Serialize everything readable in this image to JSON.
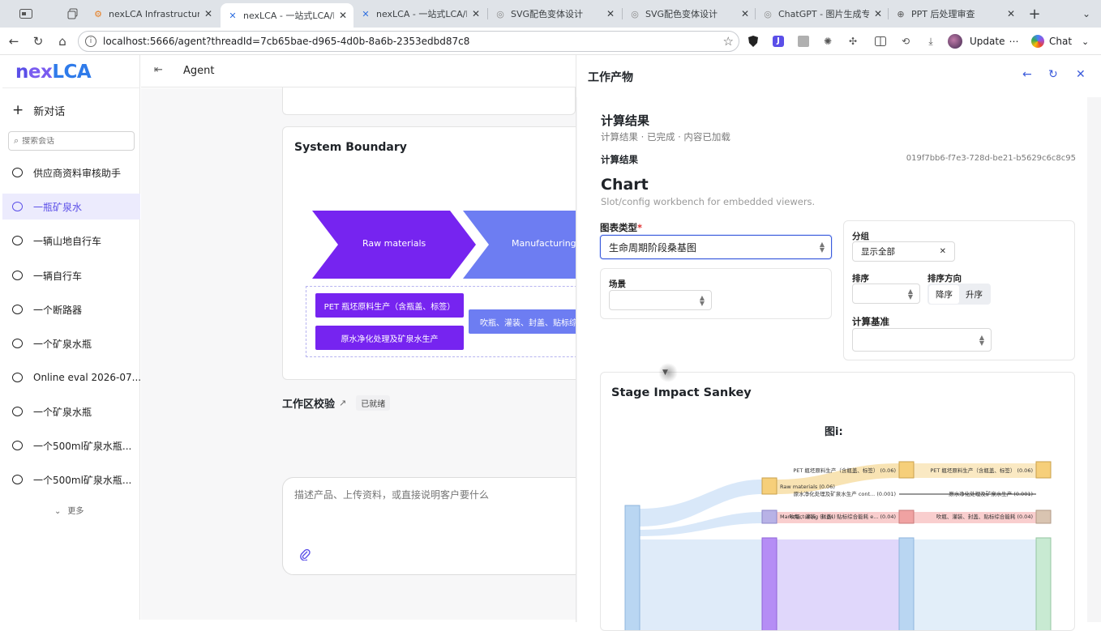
{
  "browser": {
    "tabs": [
      {
        "title": "nexLCA Infrastructure -",
        "icon": "gear-icon",
        "active": false
      },
      {
        "title": "nexLCA - 一站式LCA/EPD",
        "icon": "x-logo-icon",
        "active": true
      },
      {
        "title": "nexLCA - 一站式LCA/EPD",
        "icon": "x-logo-icon",
        "active": false
      },
      {
        "title": "SVG配色变体设计",
        "icon": "globe-icon",
        "active": false
      },
      {
        "title": "SVG配色变体设计",
        "icon": "globe-icon",
        "active": false
      },
      {
        "title": "ChatGPT - 图片生成专用",
        "icon": "globe-icon",
        "active": false
      },
      {
        "title": "PPT 后处理审查",
        "icon": "globe-icon",
        "active": false
      }
    ],
    "url": "localhost:5666/agent?threadId=7cb65bae-d965-4d0b-8a6b-2353edbd87c8",
    "update_label": "Update",
    "chat_label": "Chat"
  },
  "sidebar": {
    "logo": {
      "n": "n",
      "ex": "ex",
      "lca": "LCA"
    },
    "new_chat": "新对话",
    "search_placeholder": "搜索会话",
    "items": [
      {
        "label": "供应商资料审核助手",
        "active": false
      },
      {
        "label": "一瓶矿泉水",
        "active": true
      },
      {
        "label": "一辆山地自行车",
        "active": false
      },
      {
        "label": "一辆自行车",
        "active": false
      },
      {
        "label": "一个断路器",
        "active": false
      },
      {
        "label": "一个矿泉水瓶",
        "active": false
      },
      {
        "label": "Online eval 2026-07...",
        "active": false
      },
      {
        "label": "一个矿泉水瓶",
        "active": false
      },
      {
        "label": "一个500ml矿泉水瓶...",
        "active": false
      },
      {
        "label": "一个500ml矿泉水瓶...",
        "active": false
      }
    ],
    "more": "更多"
  },
  "main": {
    "title": "Agent",
    "system_boundary": {
      "title": "System Boundary",
      "stages": [
        "Raw materials",
        "Manufacturing"
      ],
      "processes_stage1": [
        "PET 瓶坯原料生产（含瓶盖、标签）",
        "原水净化处理及矿泉水生产"
      ],
      "processes_stage2": [
        "吹瓶、灌装、封盖、贴标综合能耗"
      ]
    },
    "workspace_check": "工作区校验",
    "workspace_status": "已就绪",
    "composer_placeholder": "描述产品、上传资料，或直接说明客户要什么"
  },
  "panel": {
    "title": "工作产物",
    "result": {
      "title": "计算结果",
      "subtitle": "计算结果 · 已完成 · 内容已加载",
      "row_label": "计算结果",
      "id": "019f7bb6-f7e3-728d-be21-b5629c6c8c95"
    },
    "chart_section": {
      "title": "Chart",
      "subtitle": "Slot/config workbench for embedded viewers.",
      "chart_type_label": "图表类型",
      "chart_type_value": "生命周期阶段桑基图",
      "scenario_label": "场景",
      "scenario_value": "",
      "group_label": "分组",
      "group_value": "显示全部",
      "sort_label": "排序",
      "sort_value": "",
      "sort_dir_label": "排序方向",
      "sort_desc": "降序",
      "sort_asc": "升序",
      "basis_label": "计算基准",
      "basis_value": ""
    },
    "sankey": {
      "title": "Stage Impact Sankey",
      "figure_label": "图i:",
      "labels": {
        "pet_left": "PET 瓶坯原料生产（含瓶盖、标签） (0.06)",
        "raw": "Raw materials (0.06)",
        "water_left": "原水净化处理及矿泉水生产 cont... (0.001)",
        "manu_overlap": "Manufacturing (0.04)",
        "blow_left": "吹瓶、灌装、封盖、贴标综合能耗 e... (0.04)",
        "pet_right": "PET 瓶坯原料生产（含瓶盖、标签） (0.06)",
        "water_right": "原水净化处理及矿泉水生产 (0.001)",
        "blow_right": "吹瓶、灌装、封盖、贴标综合能耗 (0.04)"
      }
    }
  },
  "colors": {
    "brand": "#5b4fe8",
    "stage1": "#7624f0",
    "stage2": "#6d7df2",
    "accent_blue": "#3b5bdb"
  }
}
